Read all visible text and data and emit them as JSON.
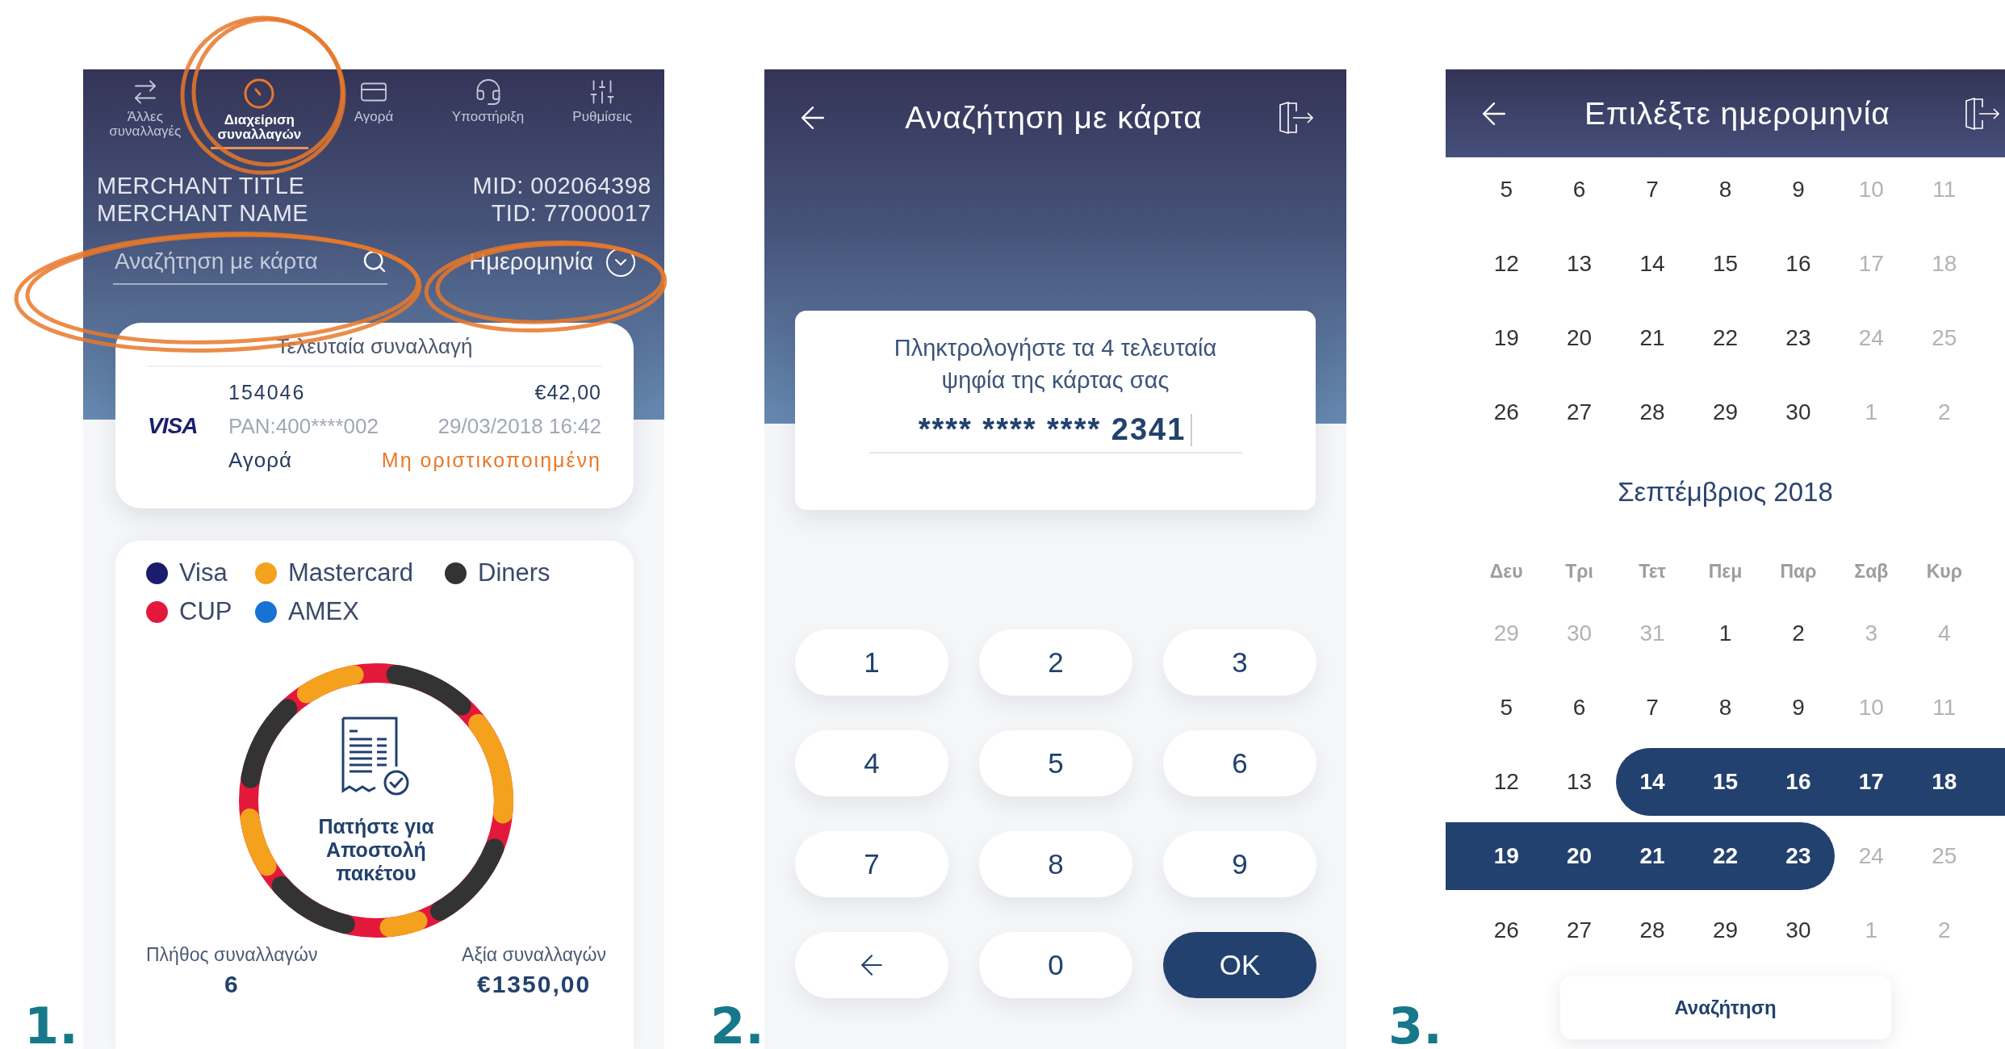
{
  "merchant_screen": {
    "number": "1.",
    "tabs": [
      {
        "label": "Άλλες συναλλαγές",
        "selected": false
      },
      {
        "label": "Διαχείριση συναλλαγών",
        "selected": true
      },
      {
        "label": "Αγορά",
        "selected": false
      },
      {
        "label": "Υποστήριξη",
        "selected": false
      },
      {
        "label": "Ρυθμίσεις",
        "selected": false
      }
    ],
    "merchant_lines": [
      "MERCHANT TITLE",
      "MERCHANT NAME"
    ],
    "terminal_ids": [
      "MID: 002064398",
      "TID: 77000017"
    ],
    "search": {
      "placeholder": "Αναζήτηση με κάρτα"
    },
    "date_filter": {
      "label": "Ημερομηνία"
    },
    "last_transaction": {
      "title": "Τελευταία συναλλαγή",
      "number": "154046",
      "amount": "€42,00",
      "card_brand": "VISA",
      "pan": "PAN:400****002",
      "datetime": "29/03/2018 16:42",
      "type": "Αγορά",
      "status": "Μη οριστικοποιημένη"
    },
    "legend": [
      {
        "label": "Visa",
        "color": "#1c1c6c"
      },
      {
        "label": "Mastercard",
        "color": "#f4a11e"
      },
      {
        "label": "Diners",
        "color": "#333333"
      },
      {
        "label": "CUP",
        "color": "#e3193b"
      },
      {
        "label": "AMEX",
        "color": "#1673d4"
      }
    ],
    "send_batch": "Πατήστε για Αποστολή πακέτου",
    "stats": [
      {
        "label": "Πλήθος συναλλαγών",
        "value": "6"
      },
      {
        "label": "Αξία συναλλαγών",
        "value": "€1350,00"
      }
    ]
  },
  "card_search_screen": {
    "number": "2.",
    "title": "Αναζήτηση με κάρτα",
    "instruction": "Πληκτρολογήστε τα 4 τελευταία ψηφία της κάρτας σας",
    "card_number": "**** **** **** 2341",
    "keys": [
      {
        "kind": "digit",
        "label": "1"
      },
      {
        "kind": "digit",
        "label": "2"
      },
      {
        "kind": "digit",
        "label": "3"
      },
      {
        "kind": "digit",
        "label": "4"
      },
      {
        "kind": "digit",
        "label": "5"
      },
      {
        "kind": "digit",
        "label": "6"
      },
      {
        "kind": "digit",
        "label": "7"
      },
      {
        "kind": "digit",
        "label": "8"
      },
      {
        "kind": "digit",
        "label": "9"
      },
      {
        "kind": "backspace"
      },
      {
        "kind": "digit",
        "label": "0"
      },
      {
        "kind": "confirm",
        "label": "OK"
      }
    ]
  },
  "date_screen": {
    "number": "3.",
    "title": "Επιλέξτε ημερομηνία",
    "upper_weeks": [
      [
        {
          "day": "5",
          "muted": false,
          "selected": false
        },
        {
          "day": "6",
          "muted": false,
          "selected": false
        },
        {
          "day": "7",
          "muted": false,
          "selected": false
        },
        {
          "day": "8",
          "muted": false,
          "selected": false
        },
        {
          "day": "9",
          "muted": false,
          "selected": false
        },
        {
          "day": "10",
          "muted": true,
          "selected": false
        },
        {
          "day": "11",
          "muted": true,
          "selected": false
        }
      ],
      [
        {
          "day": "12",
          "muted": false,
          "selected": false
        },
        {
          "day": "13",
          "muted": false,
          "selected": false
        },
        {
          "day": "14",
          "muted": false,
          "selected": false
        },
        {
          "day": "15",
          "muted": false,
          "selected": false
        },
        {
          "day": "16",
          "muted": false,
          "selected": false
        },
        {
          "day": "17",
          "muted": true,
          "selected": false
        },
        {
          "day": "18",
          "muted": true,
          "selected": false
        }
      ],
      [
        {
          "day": "19",
          "muted": false,
          "selected": false
        },
        {
          "day": "20",
          "muted": false,
          "selected": false
        },
        {
          "day": "21",
          "muted": false,
          "selected": false
        },
        {
          "day": "22",
          "muted": false,
          "selected": false
        },
        {
          "day": "23",
          "muted": false,
          "selected": false
        },
        {
          "day": "24",
          "muted": true,
          "selected": false
        },
        {
          "day": "25",
          "muted": true,
          "selected": false
        }
      ],
      [
        {
          "day": "26",
          "muted": false,
          "selected": false
        },
        {
          "day": "27",
          "muted": false,
          "selected": false
        },
        {
          "day": "28",
          "muted": false,
          "selected": false
        },
        {
          "day": "29",
          "muted": false,
          "selected": false
        },
        {
          "day": "30",
          "muted": false,
          "selected": false
        },
        {
          "day": "1",
          "muted": true,
          "selected": false
        },
        {
          "day": "2",
          "muted": true,
          "selected": false
        }
      ]
    ],
    "month_title": "Σεπτέμβριος 2018",
    "weekdays": [
      "Δευ",
      "Τρι",
      "Τετ",
      "Πεμ",
      "Παρ",
      "Σαβ",
      "Κυρ"
    ],
    "weeks": [
      [
        {
          "day": "29",
          "muted": true,
          "selected": false
        },
        {
          "day": "30",
          "muted": true,
          "selected": false
        },
        {
          "day": "31",
          "muted": true,
          "selected": false
        },
        {
          "day": "1",
          "muted": false,
          "selected": false
        },
        {
          "day": "2",
          "muted": false,
          "selected": false
        },
        {
          "day": "3",
          "muted": true,
          "selected": false
        },
        {
          "day": "4",
          "muted": true,
          "selected": false
        }
      ],
      [
        {
          "day": "5",
          "muted": false,
          "selected": false
        },
        {
          "day": "6",
          "muted": false,
          "selected": false
        },
        {
          "day": "7",
          "muted": false,
          "selected": false
        },
        {
          "day": "8",
          "muted": false,
          "selected": false
        },
        {
          "day": "9",
          "muted": false,
          "selected": false
        },
        {
          "day": "10",
          "muted": true,
          "selected": false
        },
        {
          "day": "11",
          "muted": true,
          "selected": false
        }
      ],
      [
        {
          "day": "12",
          "muted": false,
          "selected": false
        },
        {
          "day": "13",
          "muted": false,
          "selected": false
        },
        {
          "day": "14",
          "muted": false,
          "selected": true
        },
        {
          "day": "15",
          "muted": false,
          "selected": true
        },
        {
          "day": "16",
          "muted": false,
          "selected": true
        },
        {
          "day": "17",
          "muted": true,
          "selected": true
        },
        {
          "day": "18",
          "muted": true,
          "selected": true
        }
      ],
      [
        {
          "day": "19",
          "muted": false,
          "selected": true
        },
        {
          "day": "20",
          "muted": false,
          "selected": true
        },
        {
          "day": "21",
          "muted": false,
          "selected": true
        },
        {
          "day": "22",
          "muted": false,
          "selected": true
        },
        {
          "day": "23",
          "muted": false,
          "selected": true
        },
        {
          "day": "24",
          "muted": true,
          "selected": false
        },
        {
          "day": "25",
          "muted": true,
          "selected": false
        }
      ],
      [
        {
          "day": "26",
          "muted": false,
          "selected": false
        },
        {
          "day": "27",
          "muted": false,
          "selected": false
        },
        {
          "day": "28",
          "muted": false,
          "selected": false
        },
        {
          "day": "29",
          "muted": false,
          "selected": false
        },
        {
          "day": "30",
          "muted": false,
          "selected": false
        },
        {
          "day": "1",
          "muted": true,
          "selected": false
        },
        {
          "day": "2",
          "muted": true,
          "selected": false
        }
      ]
    ],
    "search_button": "Αναζήτηση"
  }
}
